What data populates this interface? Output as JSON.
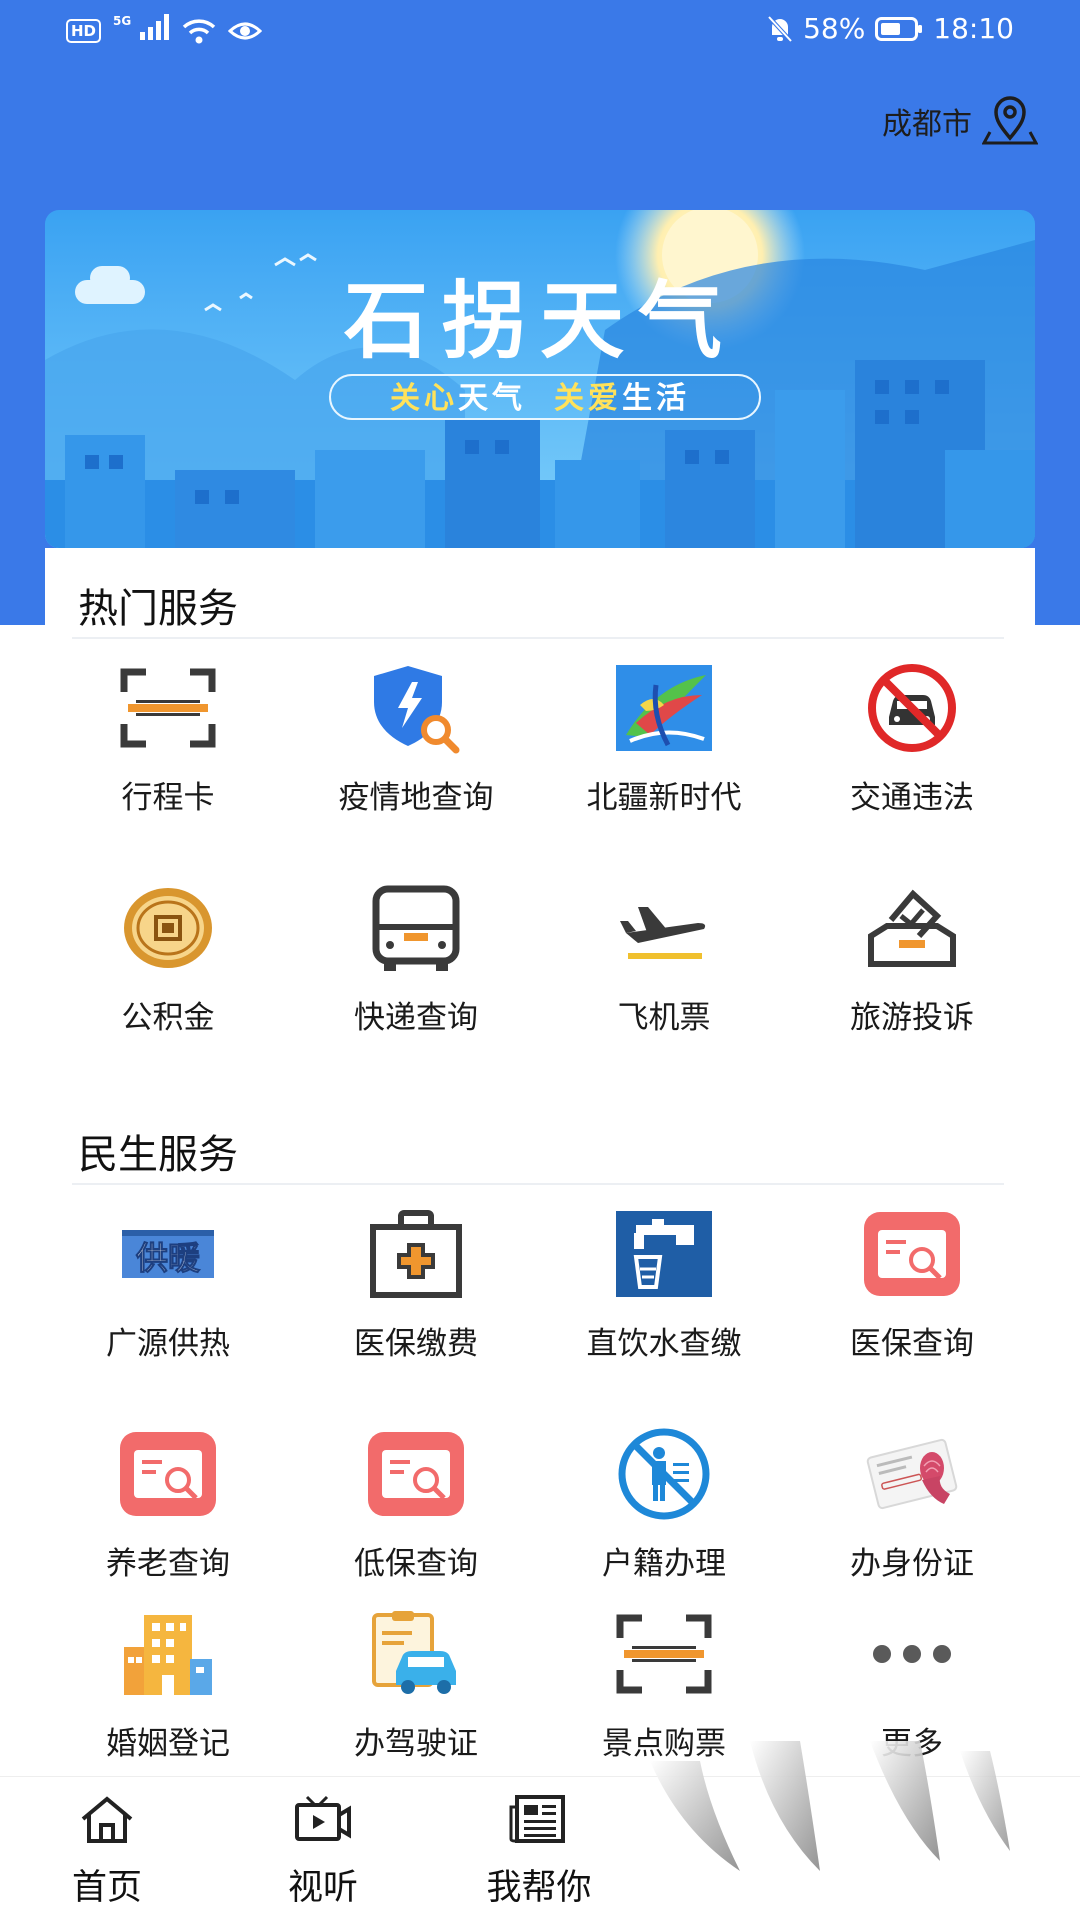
{
  "status_bar": {
    "hd": "HD",
    "network": "5G",
    "battery_percent": "58%",
    "time": "18:10"
  },
  "location": {
    "city": "成都市",
    "icon": "map-pin-icon"
  },
  "banner": {
    "title": "石拐天气",
    "slogan_part1_a": "关心",
    "slogan_part1_b": "天气",
    "slogan_part2_a": "关爱",
    "slogan_part2_b": "生活"
  },
  "hot_services": {
    "title": "热门服务",
    "items": [
      {
        "label": "行程卡",
        "icon": "scan-icon"
      },
      {
        "label": "疫情地查询",
        "icon": "shield-search-icon"
      },
      {
        "label": "北疆新时代",
        "icon": "beijiang-logo-icon"
      },
      {
        "label": "交通违法",
        "icon": "no-car-icon"
      },
      {
        "label": "公积金",
        "icon": "coin-icon"
      },
      {
        "label": "快递查询",
        "icon": "truck-icon"
      },
      {
        "label": "飞机票",
        "icon": "airplane-icon"
      },
      {
        "label": "旅游投诉",
        "icon": "ballot-box-icon"
      }
    ]
  },
  "livelihood_services": {
    "title": "民生服务",
    "items": [
      {
        "label": "广源供热",
        "icon": "heating-icon",
        "badge_text": "供暖"
      },
      {
        "label": "医保缴费",
        "icon": "medical-kit-icon"
      },
      {
        "label": "直饮水查缴",
        "icon": "water-tap-icon"
      },
      {
        "label": "医保查询",
        "icon": "card-search-icon"
      },
      {
        "label": "养老查询",
        "icon": "card-search-icon"
      },
      {
        "label": "低保查询",
        "icon": "card-search-icon"
      },
      {
        "label": "户籍办理",
        "icon": "no-person-icon"
      },
      {
        "label": "办身份证",
        "icon": "id-card-icon"
      },
      {
        "label": "婚姻登记",
        "icon": "buildings-icon"
      },
      {
        "label": "办驾驶证",
        "icon": "car-document-icon"
      },
      {
        "label": "景点购票",
        "icon": "scan-icon"
      },
      {
        "label": "更多",
        "icon": "more-dots-icon"
      }
    ]
  },
  "bottom_nav": {
    "items": [
      {
        "label": "首页",
        "icon": "home-icon"
      },
      {
        "label": "视听",
        "icon": "video-icon"
      },
      {
        "label": "我帮你",
        "icon": "news-icon"
      }
    ]
  },
  "colors": {
    "header_blue": "#3a79e8",
    "accent_orange": "#f0a030",
    "icon_dark": "#3a3a3a",
    "card_red": "#f26b6b"
  }
}
